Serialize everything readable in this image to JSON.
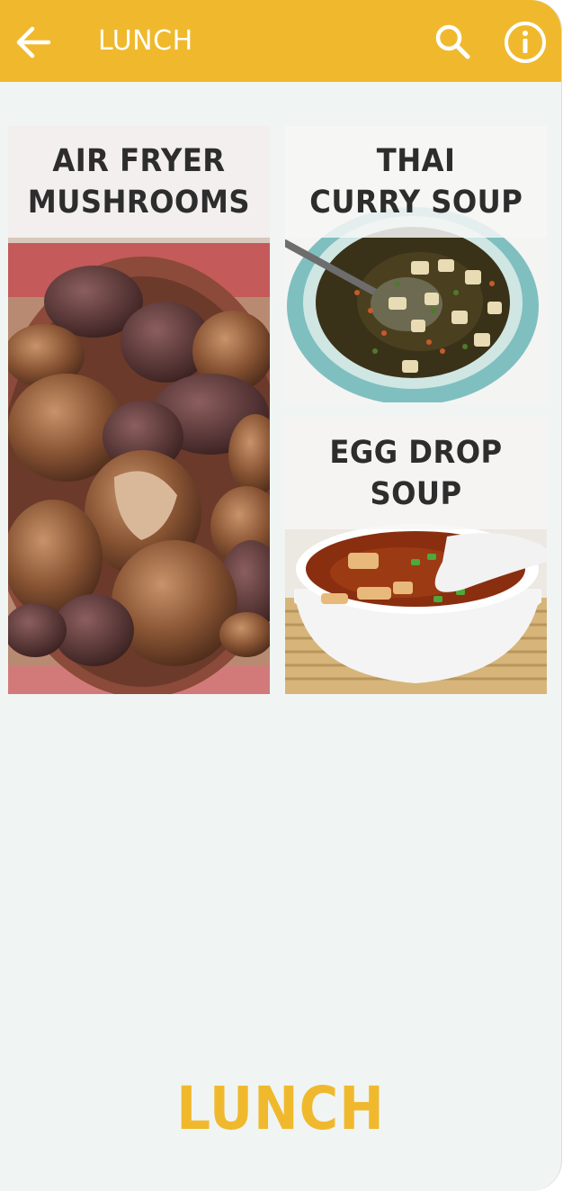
{
  "app_bar": {
    "title": "LUNCH",
    "background_color": "#f0b92d",
    "back_icon": "arrow-left-icon",
    "search_icon": "search-icon",
    "info_icon": "info-icon"
  },
  "recipes": [
    {
      "title_line1": "AIR FRYER",
      "title_line2": "MUSHROOMS"
    },
    {
      "title_line1": "THAI",
      "title_line2": "CURRY SOUP"
    },
    {
      "title_line1": "EGG DROP",
      "title_line2": "SOUP"
    }
  ],
  "footer": {
    "brand": "LUNCH",
    "color": "#f0b92d"
  }
}
